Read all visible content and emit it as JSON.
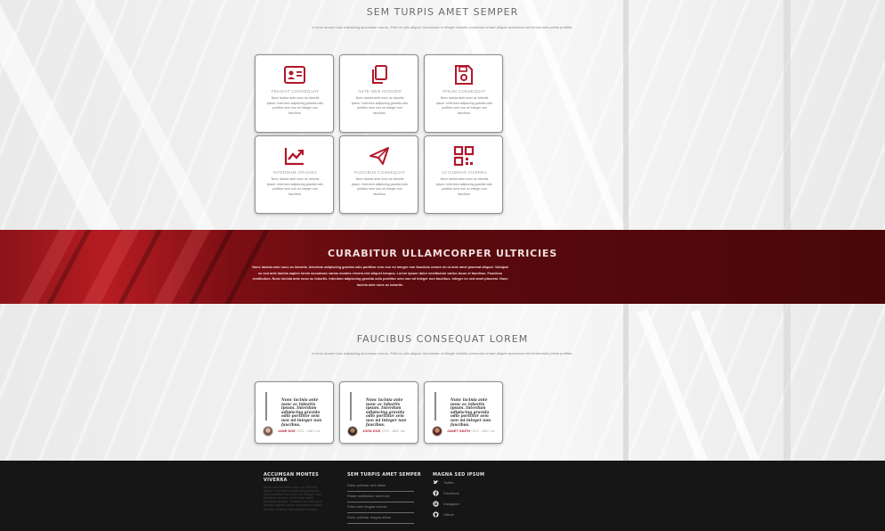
{
  "services": {
    "title": "SEM TURPIS AMET SEMPER",
    "subtitle": "In eros ornare nunc adipiscing accumsan non ac. Felis id odio aliquet. Accumsan ut integer lobortis commodo ornare aliquet accumsan nisl fermentum primis porttitor.",
    "cards": [
      {
        "icon": "id-card-icon",
        "title": "FEUGIAT CONSEQUAT",
        "text": "Nunc lacinia ante nunc ac lobortis ipsum. Interdum adipiscing gravida odio porttitor sem non mi integer non faucibus."
      },
      {
        "icon": "copy-icon",
        "title": "ANTE SEM INTEGER",
        "text": "Nunc lacinia ante nunc ac lobortis ipsum. Interdum adipiscing gravida odio porttitor sem non mi integer non faucibus."
      },
      {
        "icon": "floppy-disk-icon",
        "title": "IPSUM CONSEQUAT",
        "text": "Nunc lacinia ante nunc ac lobortis ipsum. Interdum adipiscing gravida odio porttitor sem non mi integer non faucibus."
      },
      {
        "icon": "line-chart-icon",
        "title": "INTERDUM GRAVIDA",
        "text": "Nunc lacinia ante nunc ac lobortis ipsum. Interdum adipiscing gravida odio porttitor sem non mi integer non faucibus."
      },
      {
        "icon": "paper-plane-icon",
        "title": "FAUCIBUS CONSEQUAT",
        "text": "Nunc lacinia ante nunc ac lobortis ipsum. Interdum adipiscing gravida odio porttitor sem non mi integer non faucibus."
      },
      {
        "icon": "qr-code-icon",
        "title": "ACCUMSAN VIVERRA",
        "text": "Nunc lacinia ante nunc ac lobortis ipsum. Interdum adipiscing gravida odio porttitor sem non mi integer non faucibus."
      }
    ]
  },
  "banner": {
    "title": "CURABITUR ULLAMCORPER ULTRICIES",
    "text": "Nunc lacinia ante nunc ac lobortis. Interdum adipiscing gravida odio porttitor sem non mi integer non faucibus ornare mi ut ante amet placerat aliquet. Volutpat eu sed ante lacinia sapien lorem accumsan varius montes viverra nisl aliquet tempus. Lorem ipsum dolor vestibulum varius lacus et faucibus. Faucibus vestibulum. Nunc lacinia ante nunc ac lobortis. Interdum adipiscing gravida odio porttitor sem non mi integer non faucibus. Integer eu sed amet placerat. Nunc lacinia ante nunc ac lobortis."
  },
  "testimonials": {
    "title": "FAUCIBUS CONSEQUAT LOREM",
    "subtitle": "In eros ornare nunc adipiscing accumsan non ac. Felis id odio aliquet. Accumsan ut integer lobortis commodo ornare aliquet accumsan nisl fermentum primis porttitor.",
    "items": [
      {
        "quote": "Nunc lacinia ante nunc ac lobortis ipsum. Interdum adipiscing gravida odio porttitor sem non mi integer non faucibus.",
        "name": "JANE DOE",
        "role": "CEO - ABC Inc"
      },
      {
        "quote": "Nunc lacinia ante nunc ac lobortis ipsum. Interdum adipiscing gravida odio porttitor sem non mi integer non faucibus.",
        "name": "JOHN DOE",
        "role": "CEO - ABC Inc"
      },
      {
        "quote": "Nunc lacinia ante nunc ac lobortis ipsum. Interdum adipiscing gravida odio porttitor sem non mi integer non faucibus.",
        "name": "JANET SMITH",
        "role": "CEO - ABC Inc"
      }
    ]
  },
  "footer": {
    "col1": {
      "title": "ACCUMSAN MONTES VIVERRA",
      "text": "Nunc lacinia ante nunc ac lobortis ipsum. Interdum adipiscing gravida odio porttitor sem non mi integer non faucibus ornare mi ut ante amet placerat aliquet. Volutpat eu sed ante lacinia sapien lorem accumsan varius montes viverra nisl aliquet tempus."
    },
    "col2": {
      "title": "SEM TURPIS AMET SEMPER",
      "links": [
        "Dolor pulvinar sed etiam",
        "Etiam vestibulum sed nunc",
        "Felis enim feugiat viverra",
        "Dolor pulvinar magna etiam"
      ]
    },
    "col3": {
      "title": "MAGNA SED IPSUM",
      "links": [
        {
          "icon": "twitter-icon",
          "label": "Twitter"
        },
        {
          "icon": "facebook-icon",
          "label": "Facebook"
        },
        {
          "icon": "instagram-icon",
          "label": "Instagram"
        },
        {
          "icon": "github-icon",
          "label": "Github"
        }
      ]
    }
  },
  "colors": {
    "accent": "#b0182a",
    "banner": "#6b0b10",
    "footer": "#161616"
  }
}
